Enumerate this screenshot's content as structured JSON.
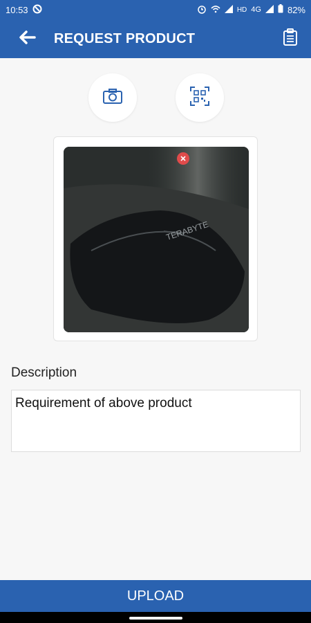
{
  "status_bar": {
    "time": "10:53",
    "network": "HD",
    "network2": "4G",
    "battery": "82%"
  },
  "app_bar": {
    "title": "REQUEST PRODUCT"
  },
  "description": {
    "label": "Description",
    "value": "Requirement of above product"
  },
  "upload": {
    "label": "UPLOAD"
  },
  "colors": {
    "primary": "#2a62b0",
    "remove": "#e04b4b"
  }
}
